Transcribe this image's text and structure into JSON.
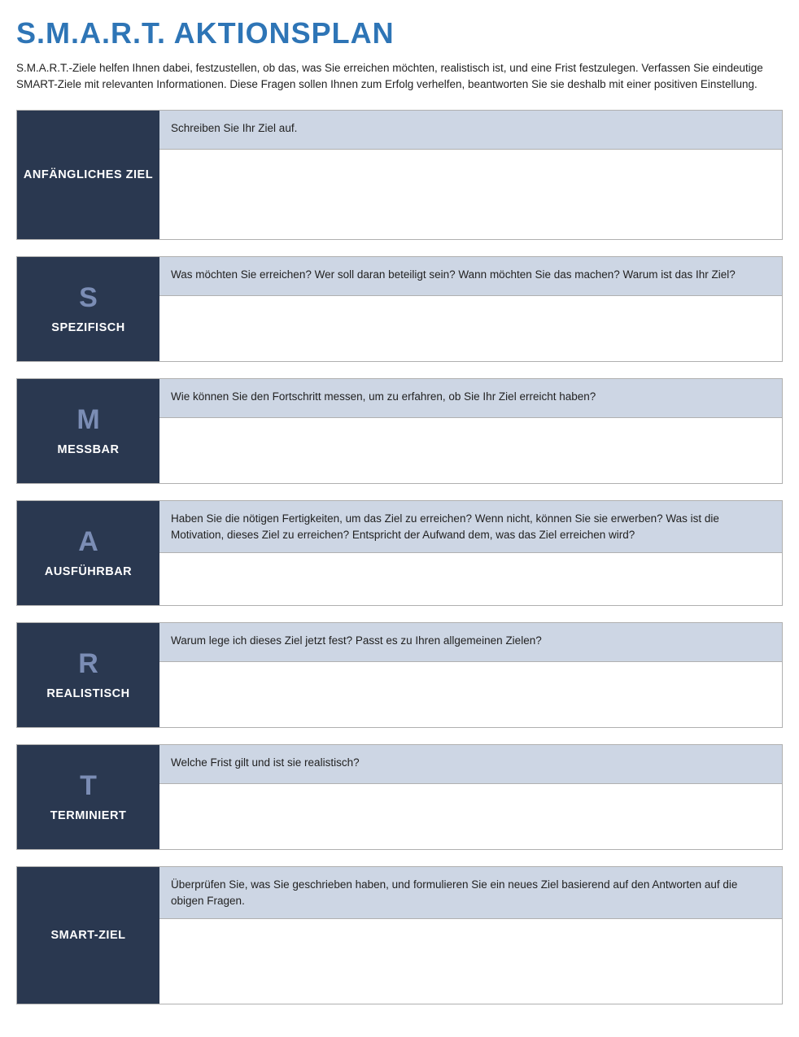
{
  "title": "S.M.A.R.T. AKTIONSPLAN",
  "intro": "S.M.A.R.T.-Ziele helfen Ihnen dabei, festzustellen, ob das, was Sie erreichen möchten, realistisch ist, und eine Frist festzulegen. Verfassen Sie eindeutige SMART-Ziele mit relevanten Informationen. Diese Fragen sollen Ihnen zum Erfolg verhelfen, beantworten Sie sie deshalb mit einer positiven Einstellung.",
  "sections": [
    {
      "letter": "",
      "word": "ANFÄNGLICHES ZIEL",
      "prompt": "Schreiben Sie Ihr Ziel auf.",
      "type": "initial"
    },
    {
      "letter": "S",
      "word": "SPEZIFISCH",
      "prompt": "Was möchten Sie erreichen? Wer soll daran beteiligt sein? Wann möchten Sie das machen? Warum ist das Ihr Ziel?",
      "type": "smart"
    },
    {
      "letter": "M",
      "word": "MESSBAR",
      "prompt": "Wie können Sie den Fortschritt messen, um zu erfahren, ob Sie Ihr Ziel erreicht haben?",
      "type": "smart"
    },
    {
      "letter": "A",
      "word": "AUSFÜHRBAR",
      "prompt": "Haben Sie die nötigen Fertigkeiten, um das Ziel zu erreichen? Wenn nicht, können Sie sie erwerben? Was ist die Motivation, dieses Ziel zu erreichen? Entspricht der Aufwand dem, was das Ziel erreichen wird?",
      "type": "smart"
    },
    {
      "letter": "R",
      "word": "REALISTISCH",
      "prompt": "Warum lege ich dieses Ziel jetzt fest? Passt es zu Ihren allgemeinen Zielen?",
      "type": "smart"
    },
    {
      "letter": "T",
      "word": "TERMINIERT",
      "prompt": "Welche Frist gilt und ist sie realistisch?",
      "type": "smart"
    },
    {
      "letter": "",
      "word": "SMART-ZIEL",
      "prompt": "Überprüfen Sie, was Sie geschrieben haben, und formulieren Sie ein neues Ziel basierend auf den Antworten auf die obigen Fragen.",
      "type": "final"
    }
  ]
}
